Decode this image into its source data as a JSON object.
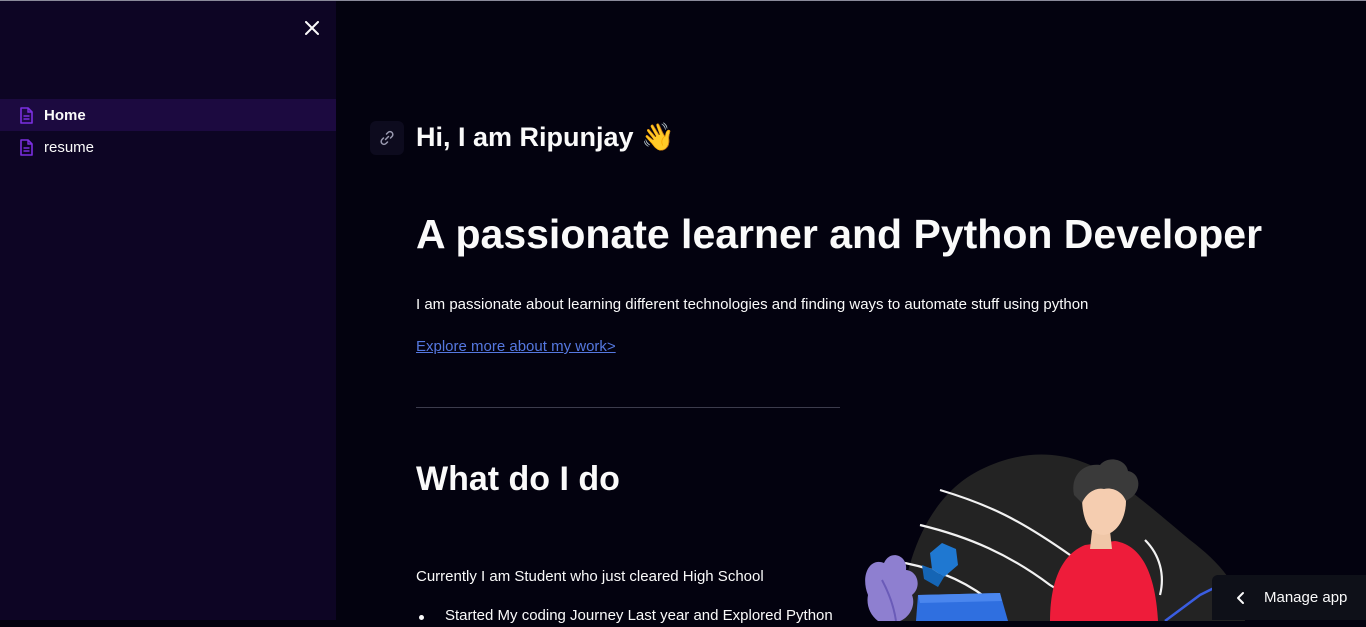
{
  "sidebar": {
    "items": [
      {
        "label": "Home",
        "icon": "document-icon",
        "active": true
      },
      {
        "label": "resume",
        "icon": "document-icon",
        "active": false
      }
    ],
    "close_icon": "close-icon"
  },
  "main": {
    "greeting": "Hi, I am Ripunjay",
    "greeting_emoji": "👋",
    "headline": "A passionate learner and Python Developer",
    "intro": "I am passionate about learning different technologies and finding ways to automate stuff using python",
    "explore_link": "Explore more about my work>",
    "section_title": "What do I do",
    "status": "Currently I am Student who just cleared High School",
    "bullets": [
      "Started My coding Journey Last year and Explored Python"
    ]
  },
  "footer": {
    "manage_app": "Manage app"
  },
  "colors": {
    "background": "#03020f",
    "sidebar": "#0d0524",
    "active_item": "#1c0a40",
    "accent_icon": "#7b2fe0",
    "link": "#5578e0"
  }
}
